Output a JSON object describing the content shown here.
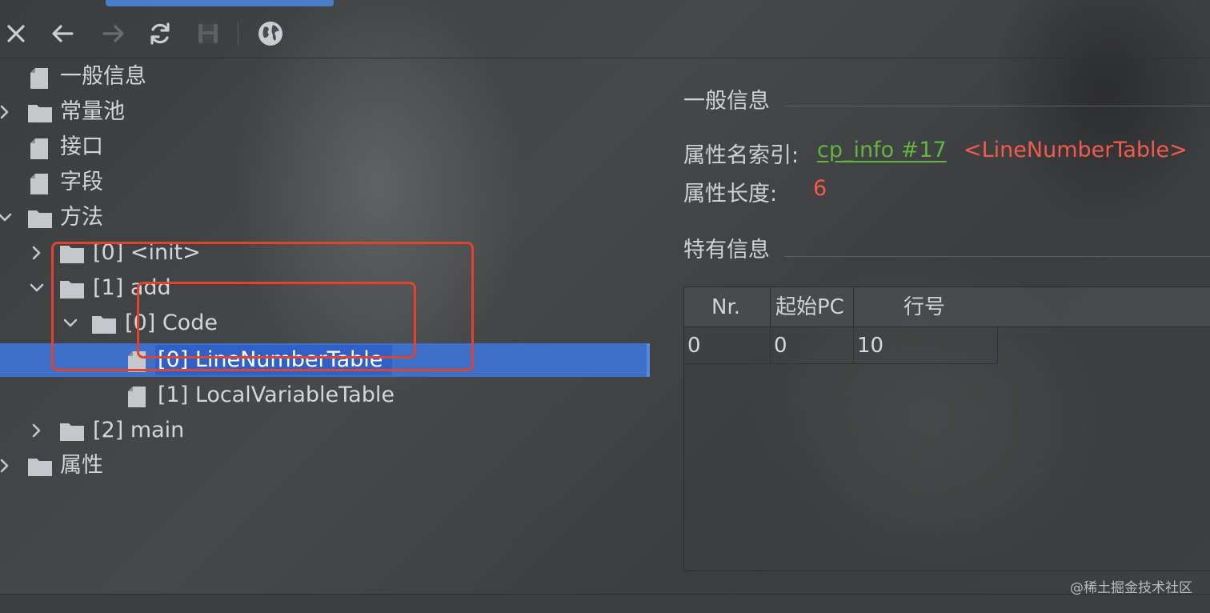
{
  "toolbar": {
    "close_icon": "close-icon",
    "back_icon": "arrow-left-icon",
    "forward_icon": "arrow-right-icon",
    "refresh_icon": "refresh-icon",
    "save_icon": "save-icon",
    "web_icon": "globe-icon"
  },
  "tree": {
    "general_info": "一般信息",
    "constant_pool": "常量池",
    "interfaces": "接口",
    "fields": "字段",
    "methods": "方法",
    "method_init": "[0] <init>",
    "method_add": "[1] add",
    "code": "[0] Code",
    "line_number_table": "[0] LineNumberTable",
    "local_variable_table": "[1] LocalVariableTable",
    "method_main": "[2] main",
    "attributes": "属性"
  },
  "panel": {
    "general_title": "一般信息",
    "attr_name_index_label": "属性名索引:",
    "attr_name_index_link": "cp_info #17",
    "attr_name_value": "<LineNumberTable>",
    "attr_length_label": "属性长度:",
    "attr_length_value": "6",
    "specific_title": "特有信息"
  },
  "table": {
    "headers": [
      "Nr.",
      "起始PC",
      "行号"
    ],
    "rows": [
      [
        "0",
        "0",
        "10"
      ]
    ]
  },
  "watermark": "@稀土掘金技术社区",
  "colors": {
    "selection": "#3e6fc9",
    "link": "#62b543",
    "value_red": "#f25b4c",
    "annotation": "#e0432f"
  }
}
